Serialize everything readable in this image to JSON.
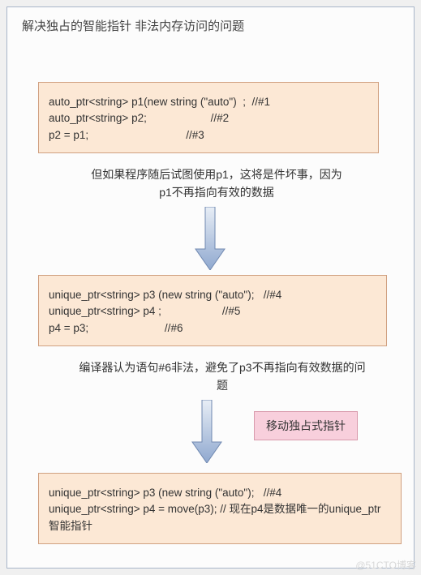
{
  "title": "解决独占的智能指针 非法内存访问的问题",
  "box1": {
    "line1": "auto_ptr<string> p1(new string (\"auto\")  ;  //#1",
    "line2": "auto_ptr<string> p2;                     //#2",
    "line3": "p2 = p1;                                //#3"
  },
  "desc1": "但如果程序随后试图使用p1，这将是件坏事，因为p1不再指向有效的数据",
  "box2": {
    "line1": "unique_ptr<string> p3 (new string (\"auto\");   //#4",
    "line2": "unique_ptr<string> p4 ;                    //#5",
    "line3": "p4 = p3;                         //#6"
  },
  "desc2": "编译器认为语句#6非法，避免了p3不再指向有效数据的问题",
  "badge": "移动独占式指针",
  "box3": {
    "line1": "unique_ptr<string> p3 (new string (\"auto\");   //#4",
    "line2": "unique_ptr<string> p4 = move(p3);     // 现在p4是数据唯一的unique_ptr智能指针"
  },
  "watermark": "@51CTO博客",
  "arrow": {
    "fill_top": "#e8eef6",
    "fill_bottom": "#8fa8cf",
    "stroke": "#6f88b0"
  }
}
